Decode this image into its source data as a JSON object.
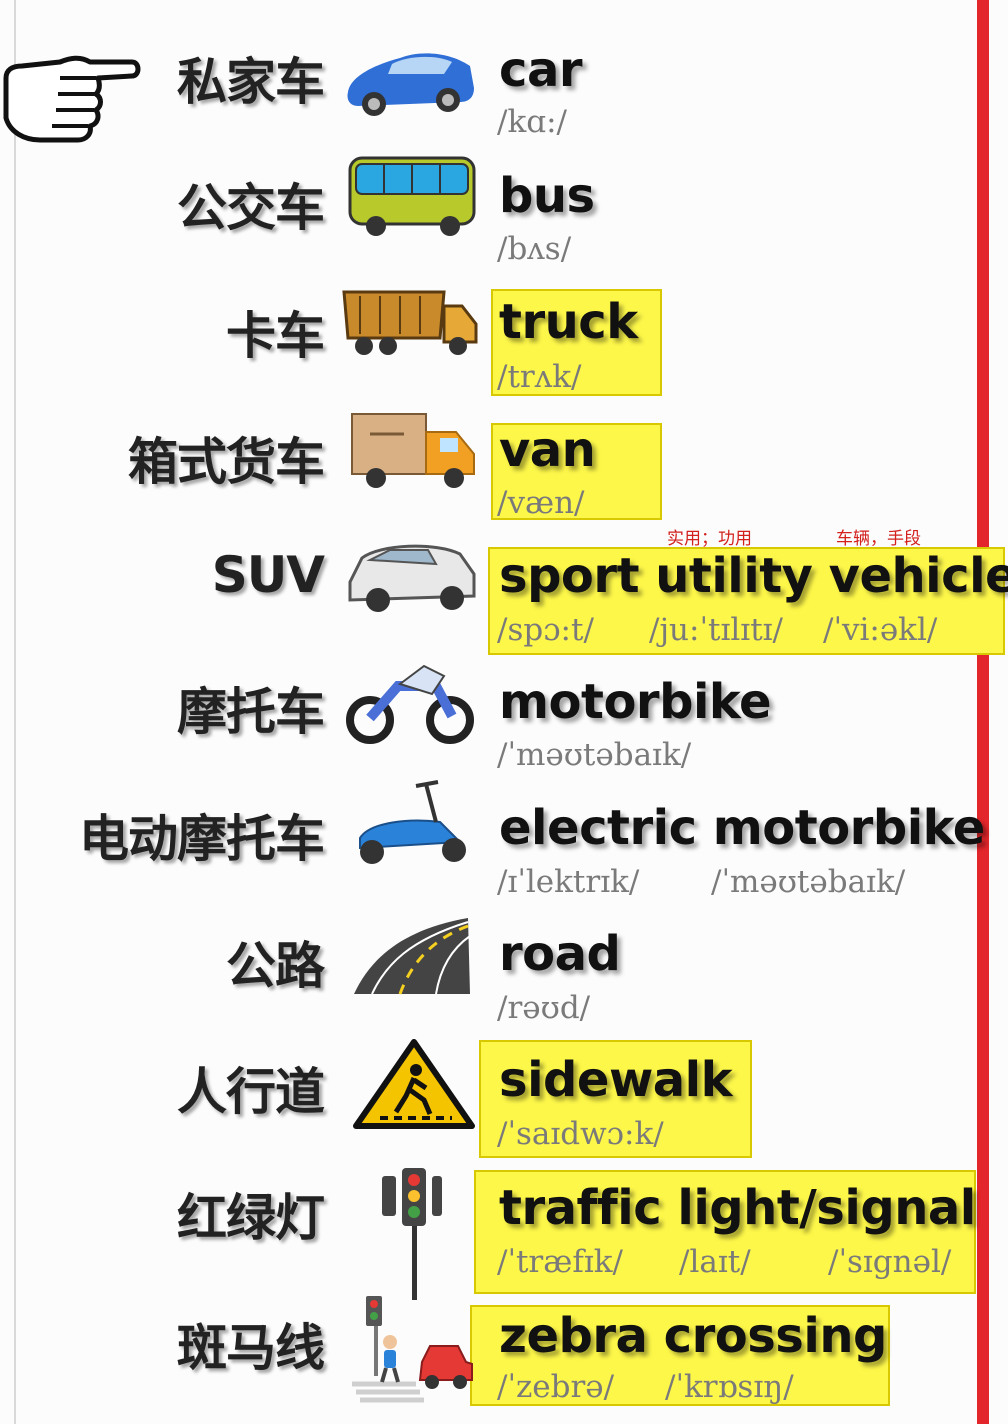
{
  "colors": {
    "highlight": "#fdf74a",
    "accent_line": "#e3262b",
    "note": "#d2201d"
  },
  "pointer": {
    "icon": "pointing-hand-icon"
  },
  "notes": [
    {
      "text": "实用；功用"
    },
    {
      "text": "车辆，手段"
    }
  ],
  "rows": [
    {
      "zh": "私家车",
      "en": "car",
      "icon": "car-icon",
      "highlighted": false,
      "phonetics": [
        "/kɑ:/"
      ]
    },
    {
      "zh": "公交车",
      "en": "bus",
      "icon": "bus-icon",
      "highlighted": false,
      "phonetics": [
        "/bʌs/"
      ]
    },
    {
      "zh": "卡车",
      "en": "truck",
      "icon": "truck-icon",
      "highlighted": true,
      "phonetics": [
        "/trʌk/"
      ]
    },
    {
      "zh": "箱式货车",
      "en": "van",
      "icon": "van-icon",
      "highlighted": true,
      "phonetics": [
        "/væn/"
      ]
    },
    {
      "zh": "SUV",
      "en": "sport utility vehicle",
      "icon": "suv-icon",
      "highlighted": true,
      "phonetics": [
        "/spɔ:t/",
        "/ju:ˈtɪlɪtɪ/",
        "/ˈvi:əkl/"
      ]
    },
    {
      "zh": "摩托车",
      "en": "motorbike",
      "icon": "motorbike-icon",
      "highlighted": false,
      "phonetics": [
        "/ˈməʊtəbaɪk/"
      ]
    },
    {
      "zh": "电动摩托车",
      "en": "electric motorbike",
      "icon": "scooter-icon",
      "highlighted": false,
      "phonetics": [
        "/ɪˈlektrɪk/",
        "/ˈməʊtəbaɪk/"
      ]
    },
    {
      "zh": "公路",
      "en": "road",
      "icon": "road-icon",
      "highlighted": false,
      "phonetics": [
        "/rəʊd/"
      ]
    },
    {
      "zh": "人行道",
      "en": "sidewalk",
      "icon": "pedestrian-sign-icon",
      "highlighted": true,
      "phonetics": [
        "/ˈsaɪdwɔ:k/"
      ]
    },
    {
      "zh": "红绿灯",
      "en": "traffic light/signal",
      "icon": "traffic-light-icon",
      "highlighted": true,
      "phonetics": [
        "/ˈtræfɪk/",
        "/laɪt/",
        "/ˈsɪgnəl/"
      ]
    },
    {
      "zh": "斑马线",
      "en": "zebra crossing",
      "icon": "zebra-crossing-icon",
      "highlighted": true,
      "phonetics": [
        "/ˈzebrə/",
        "/ˈkrɒsɪŋ/"
      ]
    }
  ]
}
